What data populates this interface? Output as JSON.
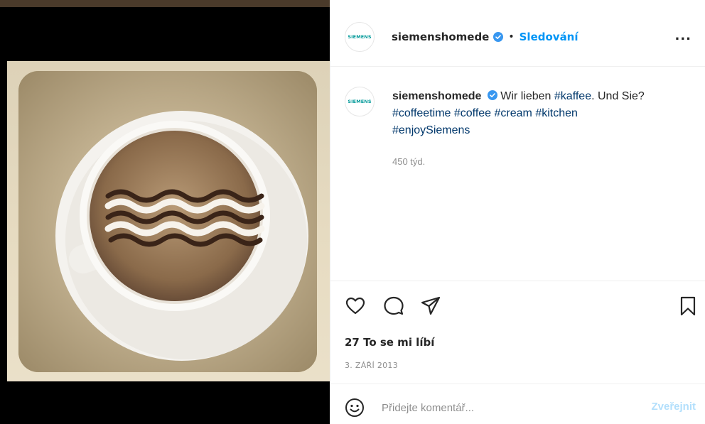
{
  "media": {
    "alt": "coffee-latte-art-photo"
  },
  "header": {
    "avatar_text": "SIEMENS",
    "username": "siemenshomede",
    "separator": "•",
    "follow_label": "Sledování",
    "more_label": "..."
  },
  "caption": {
    "avatar_text": "SIEMENS",
    "username": "siemenshomede",
    "text_before": "Wir lieben",
    "tag1": "#kaffee",
    "text_mid": ". Und Sie?",
    "tag2": "#coffeetime",
    "tag3": "#coffee",
    "tag4": "#cream",
    "tag5": "#kitchen",
    "tag6": "#enjoySiemens",
    "time": "450 týd."
  },
  "actions": {
    "likes": "27 To se mi líbí",
    "date": "3. ZÁŘÍ 2013"
  },
  "comment": {
    "placeholder": "Přidejte komentář...",
    "post_label": "Zveřejnit"
  },
  "colors": {
    "accent": "#0095f6",
    "hashtag": "#00376b",
    "muted": "#8e8e8e",
    "post_disabled": "#b2dffc"
  }
}
